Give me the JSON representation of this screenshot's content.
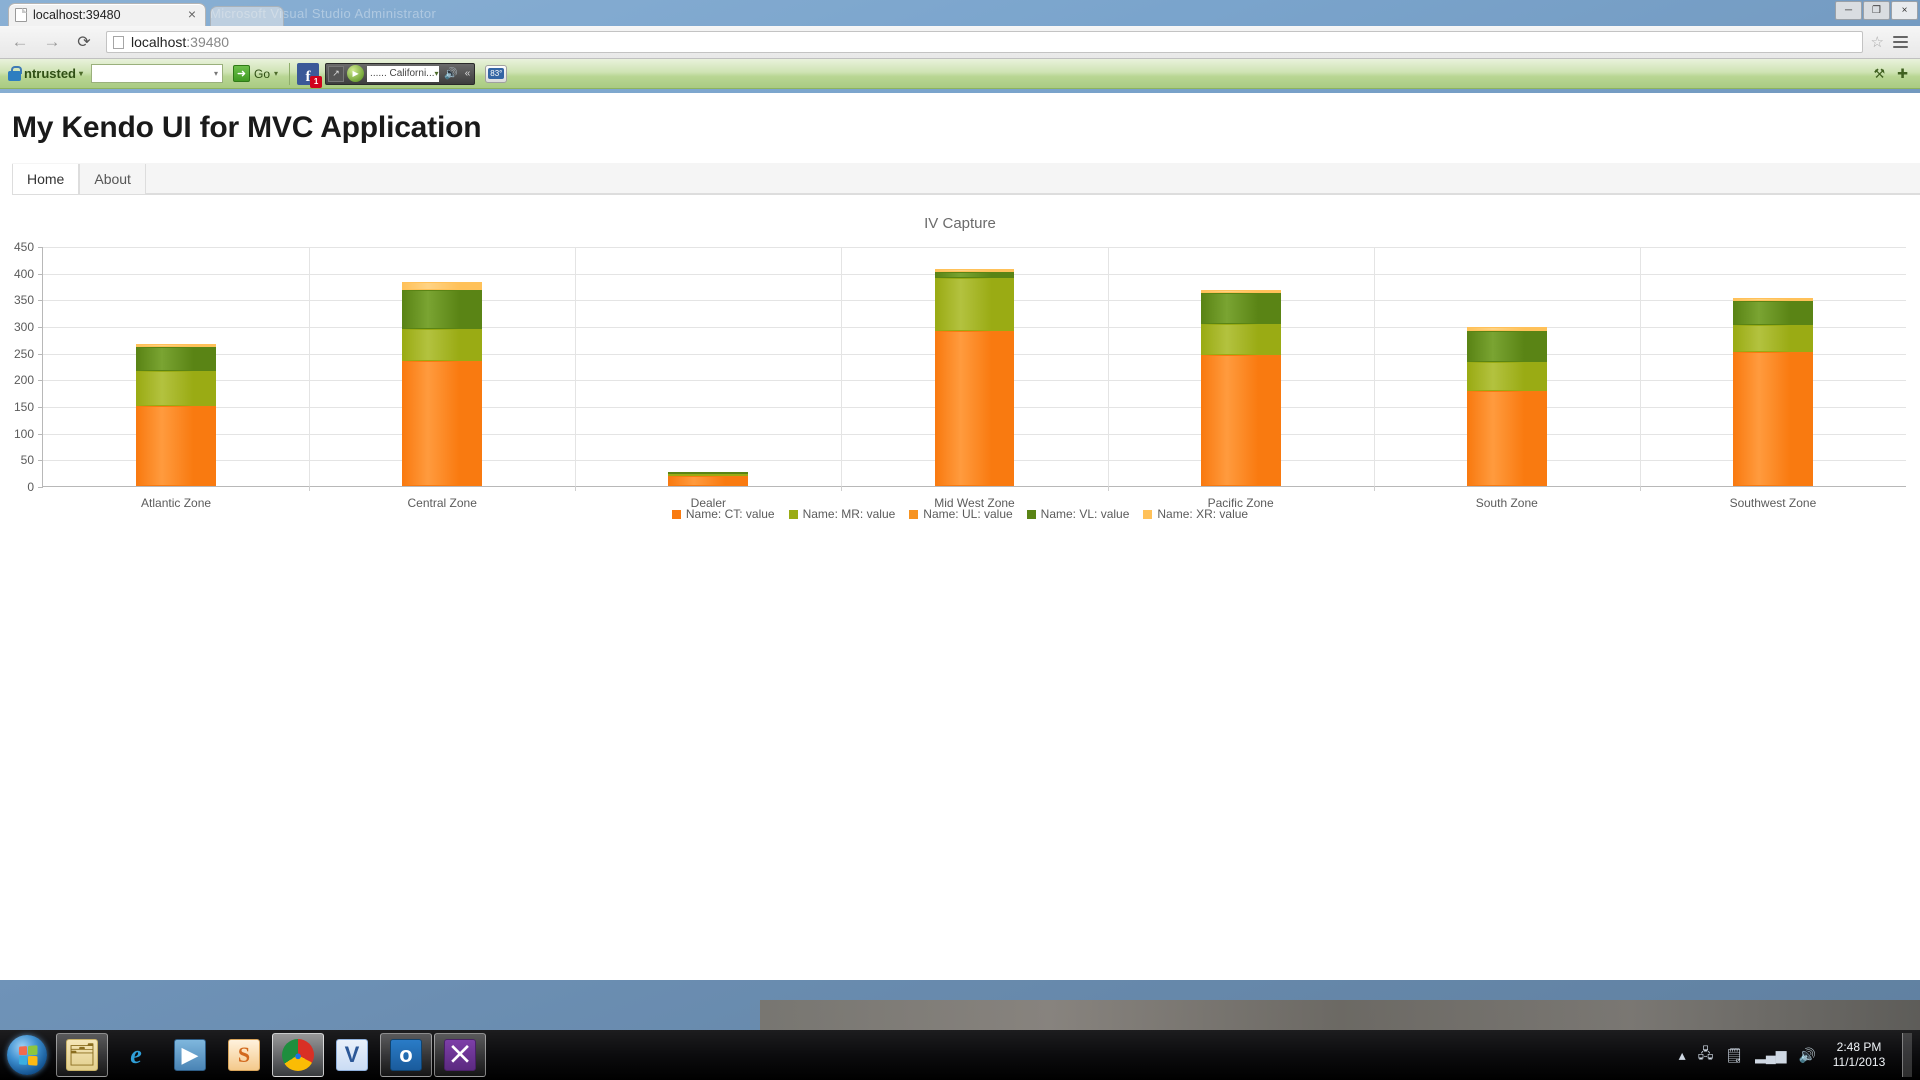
{
  "browser": {
    "tab_title": "localhost:39480",
    "tab_close": "×",
    "back_icon": "←",
    "forward_icon": "→",
    "reload_icon": "⟳",
    "url_main": "localhost",
    "url_port": ":39480",
    "star_icon": "☆",
    "window_minimize": "─",
    "window_restore": "❐",
    "window_close": "×",
    "background_window_title": "Microsoft Visual Studio Administrator"
  },
  "ext_toolbar": {
    "brand": "ntrusted",
    "brand_caret": "▾",
    "search_value": "",
    "search_caret": "▾",
    "go_label": "Go",
    "go_arrow": "➜",
    "go_caret": "▾",
    "facebook_label": "f",
    "facebook_badge": "1",
    "media_field": "...... Californi...",
    "media_field_caret": "▾",
    "media_play": "▶",
    "media_expand": "↗",
    "media_speaker": "🔊",
    "media_more": "«",
    "weather_temp": "83°",
    "right_tool_1": "⚒",
    "right_tool_2": "✚"
  },
  "site": {
    "title": "My Kendo UI for MVC Application",
    "tabs": [
      {
        "label": "Home",
        "active": true
      },
      {
        "label": "About",
        "active": false
      }
    ]
  },
  "taskbar": {
    "start_label": "Start",
    "items": [
      {
        "name": "windows-explorer",
        "glyph": "🗂",
        "state": "open"
      },
      {
        "name": "internet-explorer",
        "glyph": "e",
        "state": "idle"
      },
      {
        "name": "windows-media-player",
        "glyph": "▶",
        "state": "idle"
      },
      {
        "name": "snagit",
        "glyph": "S",
        "state": "idle"
      },
      {
        "name": "google-chrome",
        "glyph": "●",
        "state": "active"
      },
      {
        "name": "microsoft-visio",
        "glyph": "V",
        "state": "idle"
      },
      {
        "name": "microsoft-outlook",
        "glyph": "o",
        "state": "open"
      },
      {
        "name": "visual-studio",
        "glyph": "⨉",
        "state": "open"
      }
    ],
    "tray": {
      "chevron": "▴",
      "network_icon": "🖧",
      "action_center_icon": "🗒",
      "signal_icon": "▂▄▆",
      "volume_icon": "🔊",
      "time": "2:48 PM",
      "date": "11/1/2013"
    }
  },
  "chart_data": {
    "type": "bar",
    "stacked": true,
    "title": "IV Capture",
    "xlabel": "",
    "ylabel": "",
    "ylim": [
      0,
      450
    ],
    "yticks": [
      0,
      50,
      100,
      150,
      200,
      250,
      300,
      350,
      400,
      450
    ],
    "grid": true,
    "legend_position": "bottom",
    "categories": [
      "Atlantic Zone",
      "Central Zone",
      "Dealer",
      "Mid West Zone",
      "Pacific Zone",
      "South Zone",
      "Southwest Zone"
    ],
    "series": [
      {
        "name": "Name: CT: value",
        "color": "#f97a10",
        "color_light": "#ff9b3e",
        "values": [
          150,
          235,
          18,
          290,
          245,
          178,
          252
        ]
      },
      {
        "name": "Name: MR: value",
        "color": "#9aab14",
        "color_light": "#b3c23f",
        "values": [
          65,
          60,
          4,
          100,
          58,
          55,
          50
        ]
      },
      {
        "name": "Name: UL: value",
        "color": "#f79321",
        "color_light": "#ffae4e",
        "values": [
          0,
          0,
          0,
          0,
          0,
          0,
          0
        ]
      },
      {
        "name": "Name: VL: value",
        "color": "#5a8415",
        "color_light": "#7aa432",
        "values": [
          45,
          72,
          1,
          12,
          58,
          58,
          45
        ]
      },
      {
        "name": "Name: XR: value",
        "color": "#ffc159",
        "color_light": "#ffd384",
        "values": [
          6,
          15,
          0,
          5,
          6,
          7,
          5
        ]
      }
    ],
    "totals": [
      266,
      382,
      23,
      407,
      367,
      298,
      352
    ]
  }
}
